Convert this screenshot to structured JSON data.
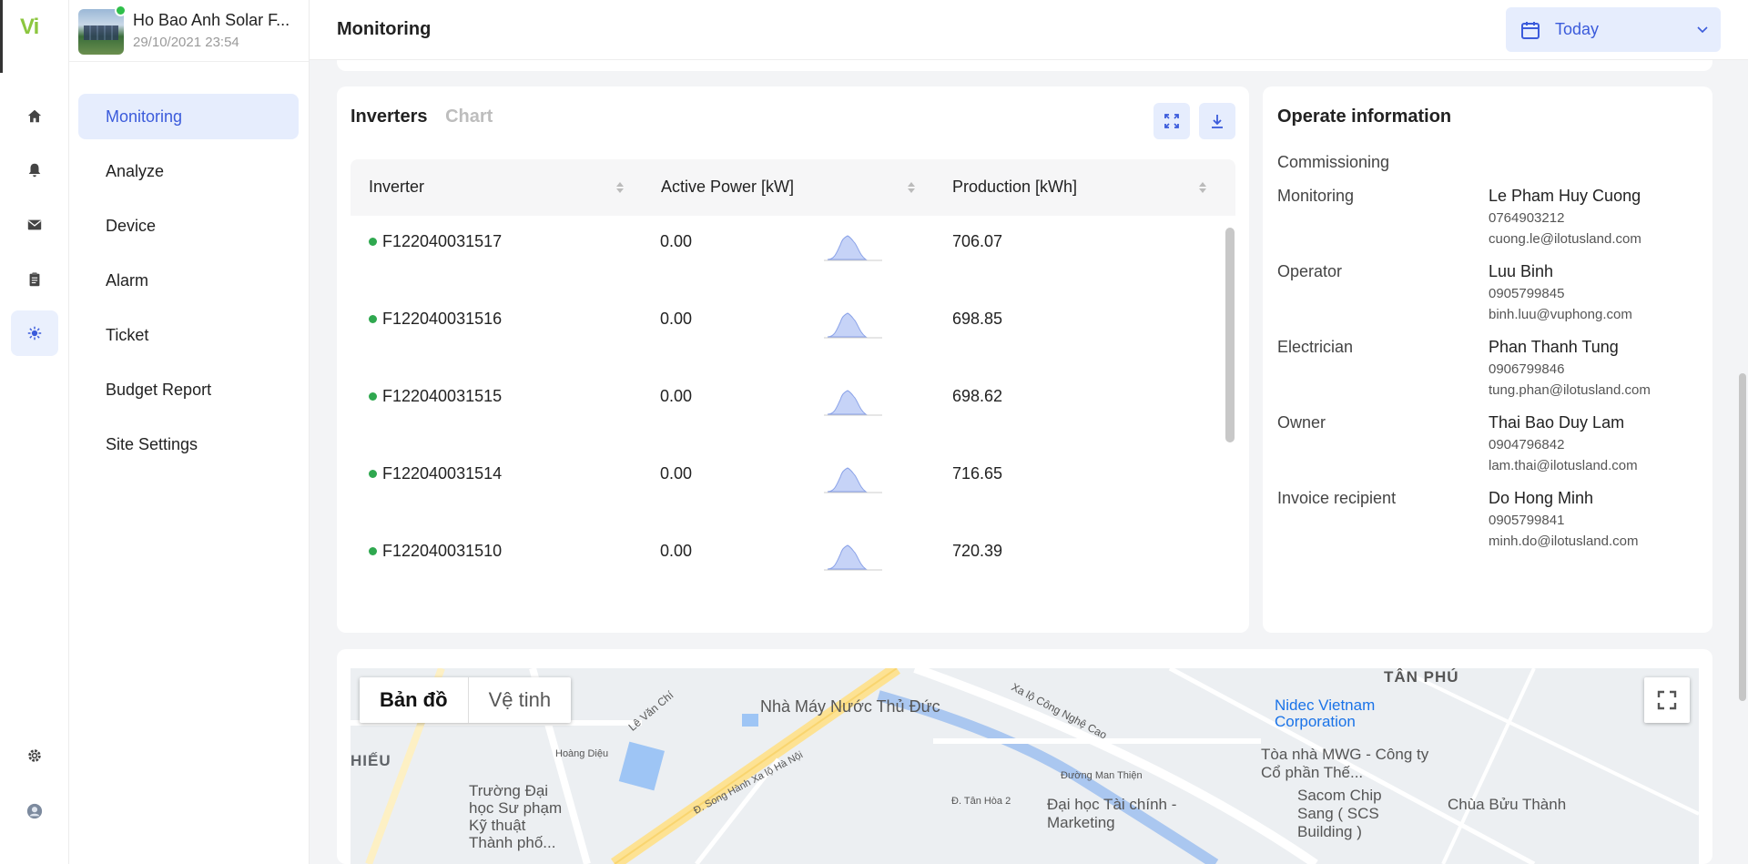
{
  "app": {
    "logo": "Vi"
  },
  "site": {
    "name": "Ho Bao Anh Solar F...",
    "datetime": "29/10/2021 23:54"
  },
  "rail": {
    "icons": [
      "home-icon",
      "bell-icon",
      "mail-icon",
      "clipboard-icon",
      "sun-icon",
      "gear-icon",
      "user-avatar"
    ]
  },
  "menu": {
    "items": [
      {
        "label": "Monitoring",
        "active": true
      },
      {
        "label": "Analyze"
      },
      {
        "label": "Device"
      },
      {
        "label": "Alarm"
      },
      {
        "label": "Ticket"
      },
      {
        "label": "Budget Report"
      },
      {
        "label": "Site Settings"
      }
    ]
  },
  "header": {
    "title": "Monitoring",
    "date_range": "Today"
  },
  "inverters": {
    "tabs": [
      "Inverters",
      "Chart"
    ],
    "columns": [
      "Inverter",
      "Active Power [kW]",
      "Production [kWh]"
    ],
    "rows": [
      {
        "name": "F122040031517",
        "power": "0.00",
        "production": "706.07",
        "status": "online"
      },
      {
        "name": "F122040031516",
        "power": "0.00",
        "production": "698.85",
        "status": "online"
      },
      {
        "name": "F122040031515",
        "power": "0.00",
        "production": "698.62",
        "status": "online"
      },
      {
        "name": "F122040031514",
        "power": "0.00",
        "production": "716.65",
        "status": "online"
      },
      {
        "name": "F122040031510",
        "power": "0.00",
        "production": "720.39",
        "status": "online"
      }
    ]
  },
  "operate": {
    "title": "Operate information",
    "roles": [
      {
        "role": "Commissioning",
        "name": "",
        "phone": "",
        "email": ""
      },
      {
        "role": "Monitoring",
        "name": "Le Pham Huy Cuong",
        "phone": "0764903212",
        "email": "cuong.le@ilotusland.com"
      },
      {
        "role": "Operator",
        "name": "Luu Binh",
        "phone": "0905799845",
        "email": "binh.luu@vuphong.com"
      },
      {
        "role": "Electrician",
        "name": "Phan Thanh Tung",
        "phone": "0906799846",
        "email": "tung.phan@ilotusland.com"
      },
      {
        "role": "Owner",
        "name": "Thai Bao Duy Lam",
        "phone": "0904796842",
        "email": "lam.thai@ilotusland.com"
      },
      {
        "role": "Invoice recipient",
        "name": "Do Hong Minh",
        "phone": "0905799841",
        "email": "minh.do@ilotusland.com"
      }
    ]
  },
  "map": {
    "types": [
      "Bản đồ",
      "Vệ tinh"
    ],
    "labels": {
      "tan_phu": "TÂN PHÚ",
      "water_plant": "Nhà Máy Nước Thủ Đức",
      "nidec": "Nidec Vietnam Corporation",
      "mwg": "Tòa nhà MWG - Công ty Cổ phần Thế...",
      "sacom": "Sacom Chip Sang ( SCS Building )",
      "chua": "Chùa Bửu Thành",
      "tai_chinh": "Đại học Tài chính - Marketing",
      "su_pham": "Trường Đại học Sư phạm Kỹ thuật Thành phố...",
      "hieu": "HIẾU",
      "le_van_chi": "Lê Văn Chí",
      "cong_nghe_cao": "Xa lộ Công Nghệ Cao",
      "song_hanh": "Đ. Song Hành Xa lộ Hà Nội",
      "tang_nhon": "Đường Man Thiện",
      "hoang_dieu": "Hoàng Diệu",
      "tan_hoa": "Đ. Tân Hòa 2"
    }
  }
}
